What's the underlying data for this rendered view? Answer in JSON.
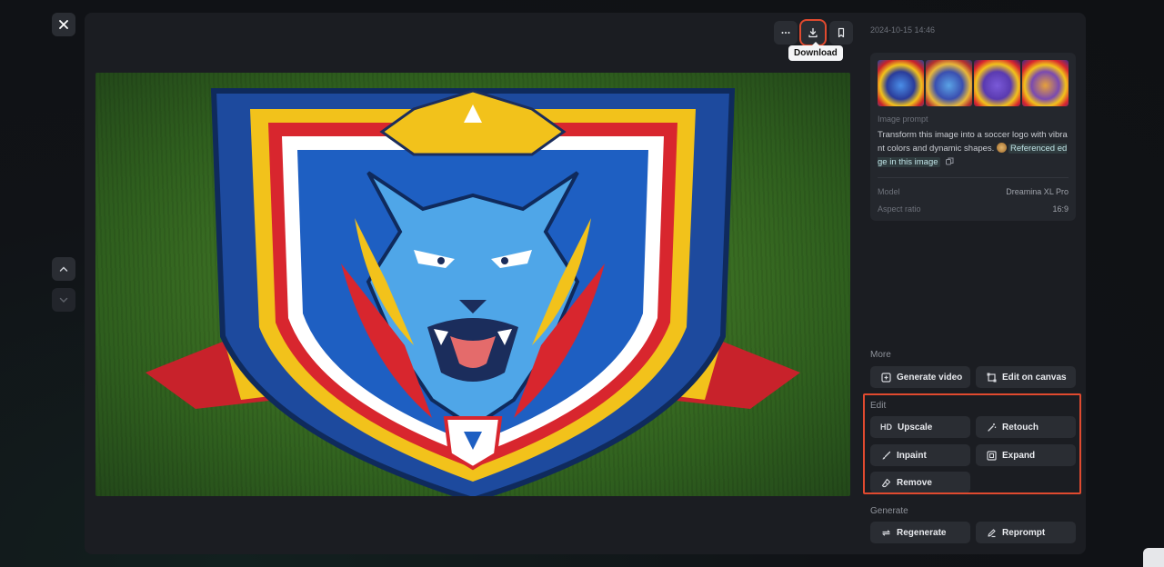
{
  "toolbar": {
    "download_tooltip": "Download"
  },
  "timestamp": "2024-10-15 14:46",
  "info": {
    "prompt_label": "Image prompt",
    "prompt_text": "Transform this image into a soccer logo with vibrant colors and dynamic shapes.",
    "reference_label": "Referenced edge in this image",
    "model_label": "Model",
    "model_value": "Dreamina XL Pro",
    "aspect_label": "Aspect ratio",
    "aspect_value": "16:9"
  },
  "sections": {
    "more": {
      "title": "More",
      "generate_video": "Generate video",
      "edit_on_canvas": "Edit on canvas"
    },
    "edit": {
      "title": "Edit",
      "upscale": "Upscale",
      "upscale_prefix": "HD",
      "retouch": "Retouch",
      "inpaint": "Inpaint",
      "expand": "Expand",
      "remove": "Remove"
    },
    "generate": {
      "title": "Generate",
      "regenerate": "Regenerate",
      "reprompt": "Reprompt"
    }
  },
  "colors": {
    "highlight": "#e04a2f",
    "panel": "#1b1d22",
    "button": "#2a2d33"
  },
  "icons": [
    "close-icon",
    "chevron-up-icon",
    "chevron-down-icon",
    "more-icon",
    "download-icon",
    "bookmark-icon",
    "copy-icon"
  ]
}
